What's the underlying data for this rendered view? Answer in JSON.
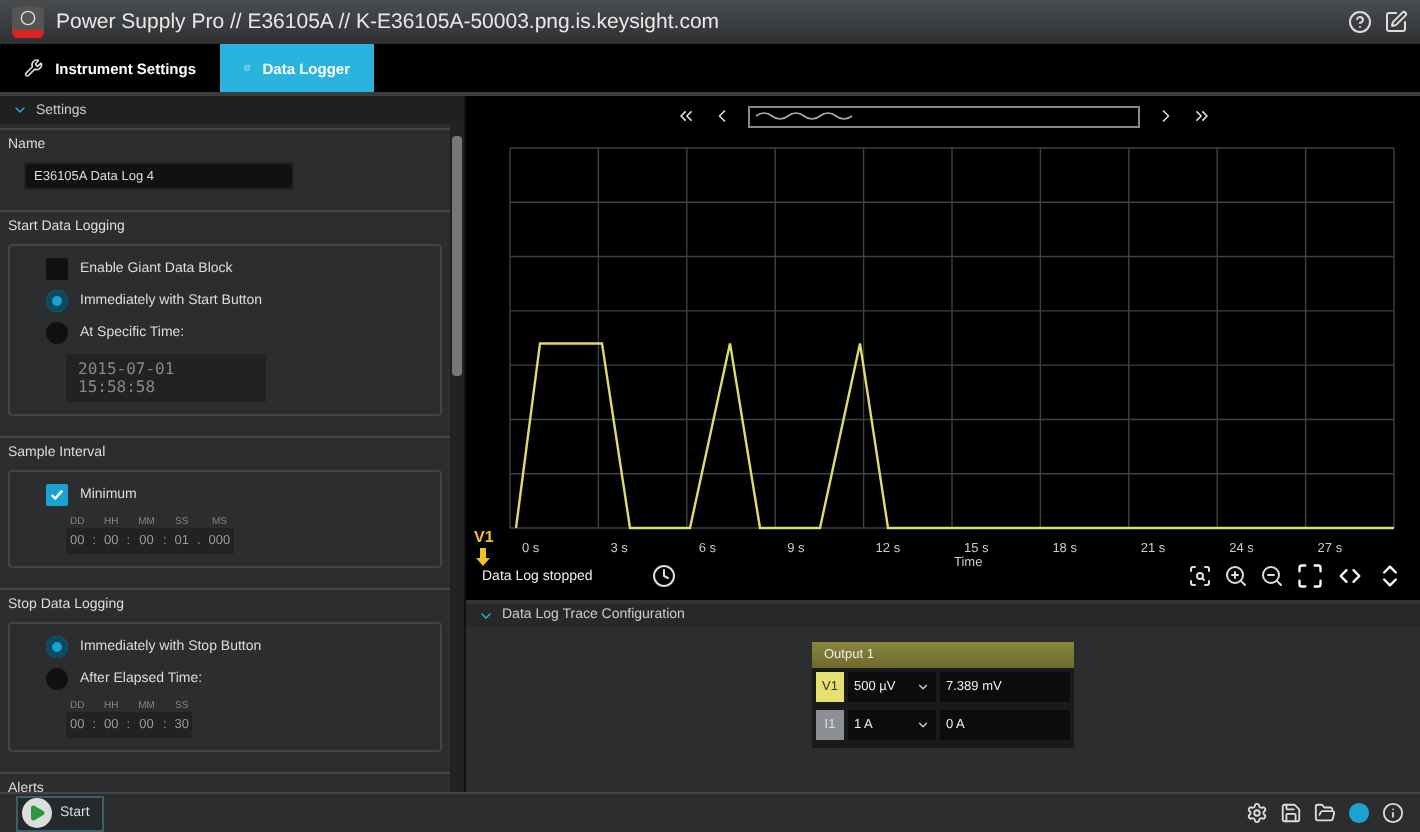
{
  "window": {
    "title": "Power Supply Pro // E36105A // K-E36105A-50003.png.is.keysight.com"
  },
  "tabs": [
    {
      "label": "Instrument Settings",
      "selected": false
    },
    {
      "label": "Data Logger",
      "selected": true
    }
  ],
  "settings": {
    "header": "Settings",
    "expanded": true,
    "name": {
      "label": "Name",
      "value": "E36105A Data Log 4"
    },
    "start_logging": {
      "label": "Start Data Logging",
      "options": [
        {
          "kind": "checkbox",
          "label": "Enable Giant Data Block",
          "checked": false
        },
        {
          "kind": "radio",
          "label": "Immediately with Start Button",
          "selected": true
        },
        {
          "kind": "radio",
          "label": "At Specific Time:",
          "selected": false
        }
      ],
      "time_value": "2015-07-01 15:58:58"
    },
    "sample_interval": {
      "label": "Sample Interval",
      "minimum": {
        "label": "Minimum",
        "checked": true
      },
      "units": [
        "DD",
        "HH",
        "MM",
        "SS",
        "MS"
      ],
      "values": [
        "00",
        "00",
        "00",
        "01",
        "000"
      ],
      "separators": [
        ":",
        ":",
        ":",
        "."
      ]
    },
    "stop_logging": {
      "label": "Stop Data Logging",
      "options": [
        {
          "kind": "radio",
          "label": "Immediately with Stop Button",
          "selected": true
        },
        {
          "kind": "radio",
          "label": "After Elapsed Time:",
          "selected": false
        }
      ],
      "units": [
        "DD",
        "HH",
        "MM",
        "SS"
      ],
      "values": [
        "00",
        "00",
        "00",
        "30"
      ],
      "separators": [
        ":",
        ":",
        ":"
      ]
    },
    "alerts": {
      "label": "Alerts"
    }
  },
  "start_button": {
    "label": "Start"
  },
  "chart": {
    "trace_label": "V1",
    "x_ticks": [
      "0 s",
      "3 s",
      "6 s",
      "9 s",
      "12 s",
      "15 s",
      "18 s",
      "21 s",
      "24 s",
      "27 s"
    ],
    "x_label": "Time"
  },
  "status": "Data Log stopped",
  "trace_config": {
    "header": "Data Log Trace Configuration",
    "expanded": true,
    "output": "Output 1",
    "rows": [
      {
        "label": "V1",
        "scale": "500 µV",
        "value": "7.389 mV",
        "active": true
      },
      {
        "label": "I1",
        "scale": "1 A",
        "value": "0 A",
        "active": false
      }
    ]
  }
}
